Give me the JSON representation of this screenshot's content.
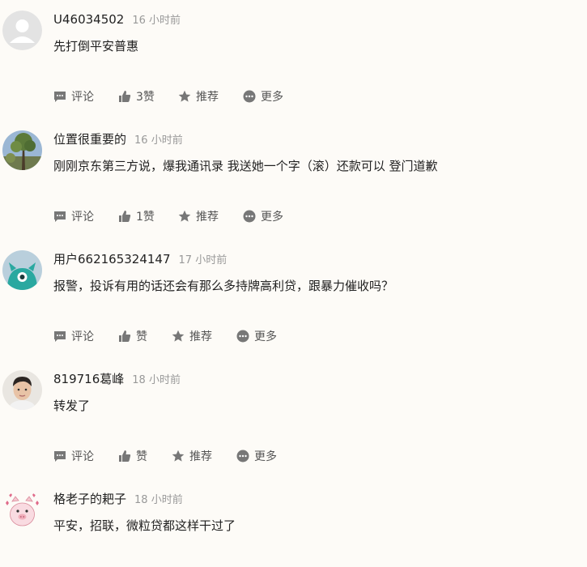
{
  "actions": {
    "comment": "评论",
    "recommend": "推荐",
    "more": "更多"
  },
  "comments": [
    {
      "user": "U46034502",
      "time": "16 小时前",
      "text": "先打倒平安普惠",
      "likes": "3赞",
      "avatar_icon": "default-user-avatar"
    },
    {
      "user": "位置很重要的",
      "time": "16 小时前",
      "text": "刚刚京东第三方说，爆我通讯录 我送她一个字（滚）还款可以 登门道歉",
      "likes": "1赞",
      "avatar_icon": "tree-photo-avatar"
    },
    {
      "user": "用户662165324147",
      "time": "17 小时前",
      "text": "报警，投诉有用的话还会有那么多持牌高利贷，跟暴力催收吗？",
      "likes": "赞",
      "avatar_icon": "teal-monster-avatar"
    },
    {
      "user": "819716葛峰",
      "time": "18 小时前",
      "text": "转发了",
      "likes": "赞",
      "avatar_icon": "person-photo-avatar"
    },
    {
      "user": "格老子的耙子",
      "time": "18 小时前",
      "text": "平安，招联，微粒贷都这样干过了",
      "avatar_icon": "pig-avatar"
    }
  ]
}
